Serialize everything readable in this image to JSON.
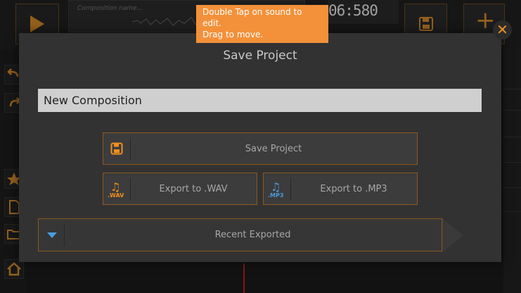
{
  "topbar": {
    "composition_placeholder": "Composition name...",
    "time": "06:580"
  },
  "tooltip": {
    "line1": "Double Tap on sound to",
    "line2": "edit.",
    "line3": "Drag to move."
  },
  "dialog": {
    "title": "Save Project",
    "name_value": "New Composition",
    "save_label": "Save Project",
    "wav": {
      "label": "Export to .WAV",
      "ext": ".WAV"
    },
    "mp3": {
      "label": "Export to .MP3",
      "ext": ".MP3"
    },
    "recent_label": "Recent Exported",
    "close_glyph": "✕"
  },
  "colors": {
    "accent": "#f0901e",
    "dialog_bg": "#333232",
    "button_border": "#8a5a1f",
    "mp3_icon": "#4a9be0",
    "tooltip_bg": "#f3913a"
  },
  "icons": {
    "play": "play-icon",
    "disk": "floppy-disk-icon",
    "plus": "plus-icon",
    "undo": "undo-icon",
    "redo": "redo-icon",
    "star": "star-icon",
    "file": "file-icon",
    "folder": "folder-icon",
    "home": "home-icon",
    "pencil": "pencil-icon",
    "recent": "chevron-down-icon"
  }
}
